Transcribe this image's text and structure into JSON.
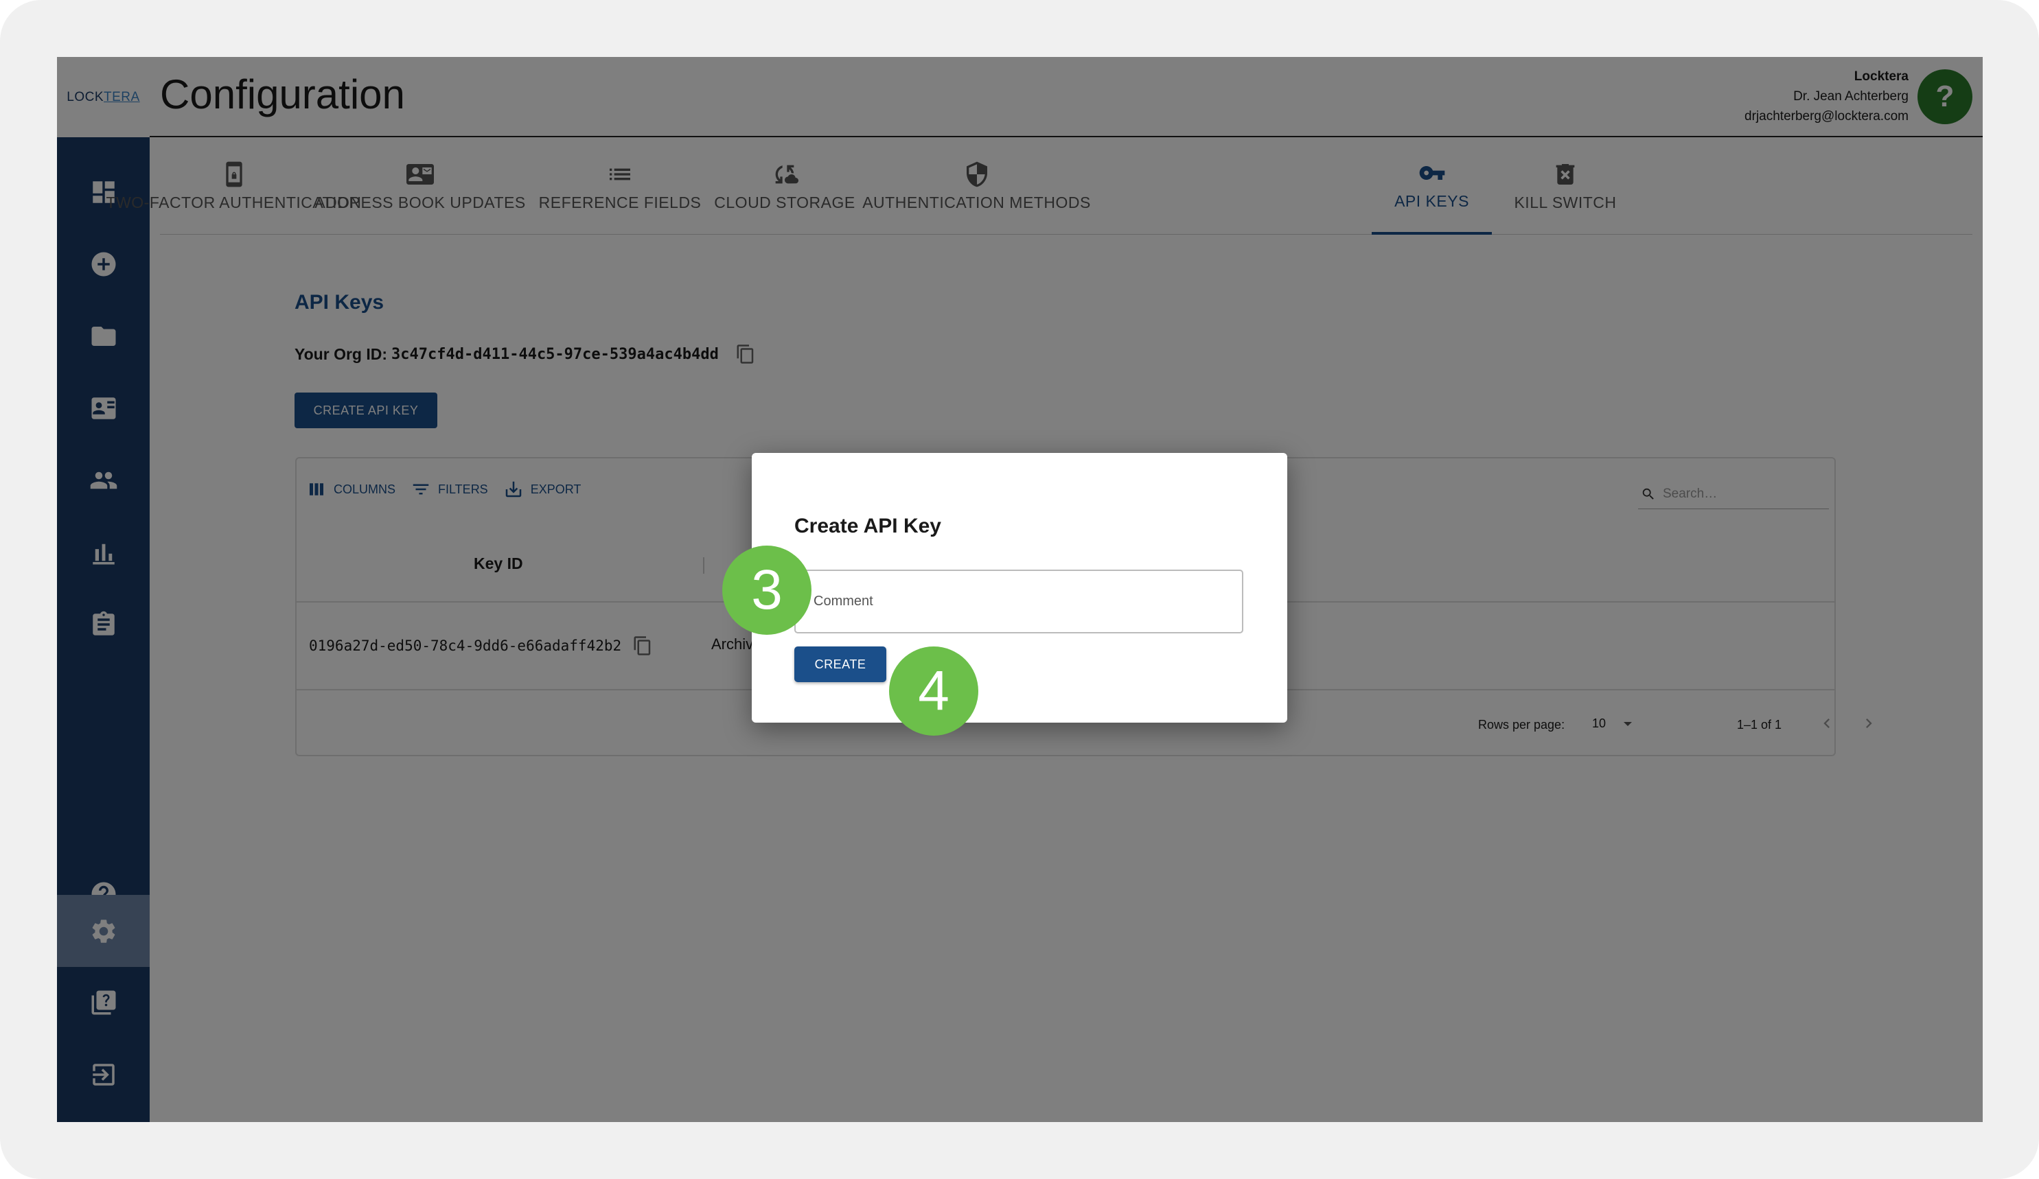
{
  "app": {
    "logo_lock": "LOCK",
    "logo_tera": "TERA",
    "page_title": "Configuration"
  },
  "user": {
    "org": "Locktera",
    "name": "Dr. Jean Achterberg",
    "email": "drjachterberg@locktera.com",
    "help_label": "?"
  },
  "sidebar": {
    "items": [
      {
        "icon": "dashboard-icon"
      },
      {
        "icon": "add-circle-icon"
      },
      {
        "icon": "folder-icon"
      },
      {
        "icon": "contact-card-icon"
      },
      {
        "icon": "people-icon"
      },
      {
        "icon": "bar-chart-icon"
      },
      {
        "icon": "clipboard-icon"
      },
      {
        "icon": "help-icon"
      },
      {
        "icon": "gear-icon"
      },
      {
        "icon": "help-book-icon"
      },
      {
        "icon": "logout-icon"
      }
    ],
    "active_icon": "gear-icon",
    "colors": {
      "background": "#1b3a66",
      "active": "#6f87a8"
    }
  },
  "tabs": [
    {
      "label": "TWO-FACTOR AUTHENTICATION",
      "icon": "phone-lock-icon"
    },
    {
      "label": "ADDRESS BOOK UPDATES",
      "icon": "contact-mail-icon"
    },
    {
      "label": "REFERENCE FIELDS",
      "icon": "list-icon"
    },
    {
      "label": "CLOUD STORAGE",
      "icon": "cloud-sync-icon"
    },
    {
      "label": "AUTHENTICATION METHODS",
      "icon": "shield-icon"
    },
    {
      "label": "API KEYS",
      "icon": "key-icon",
      "active": true
    },
    {
      "label": "KILL SWITCH",
      "icon": "trash-x-icon"
    }
  ],
  "api_keys": {
    "title": "API Keys",
    "org_id_label": "Your Org ID:",
    "org_id_value": "3c47cf4d-d411-44c5-97ce-539a4ac4b4dd",
    "create_button": "CREATE API KEY",
    "toolbar": {
      "columns": "COLUMNS",
      "filters": "FILTERS",
      "export": "EXPORT"
    },
    "search_placeholder": "Search…",
    "columns": [
      "Key ID"
    ],
    "rows": [
      {
        "key_id": "0196a27d-ed50-78c4-9dd6-e66adaff42b2",
        "status": "Archiv"
      }
    ],
    "pagination": {
      "rows_per_page_label": "Rows per page:",
      "rows_per_page_value": "10",
      "range": "1–1 of 1"
    }
  },
  "dialog": {
    "title": "Create API Key",
    "comment_placeholder": "Comment",
    "create_button": "CREATE"
  },
  "steps": {
    "step3": "3",
    "step4": "4"
  },
  "colors": {
    "primary": "#1b4f8a",
    "step_badge": "#6cbf4a",
    "help_button": "#2b7a2b"
  }
}
